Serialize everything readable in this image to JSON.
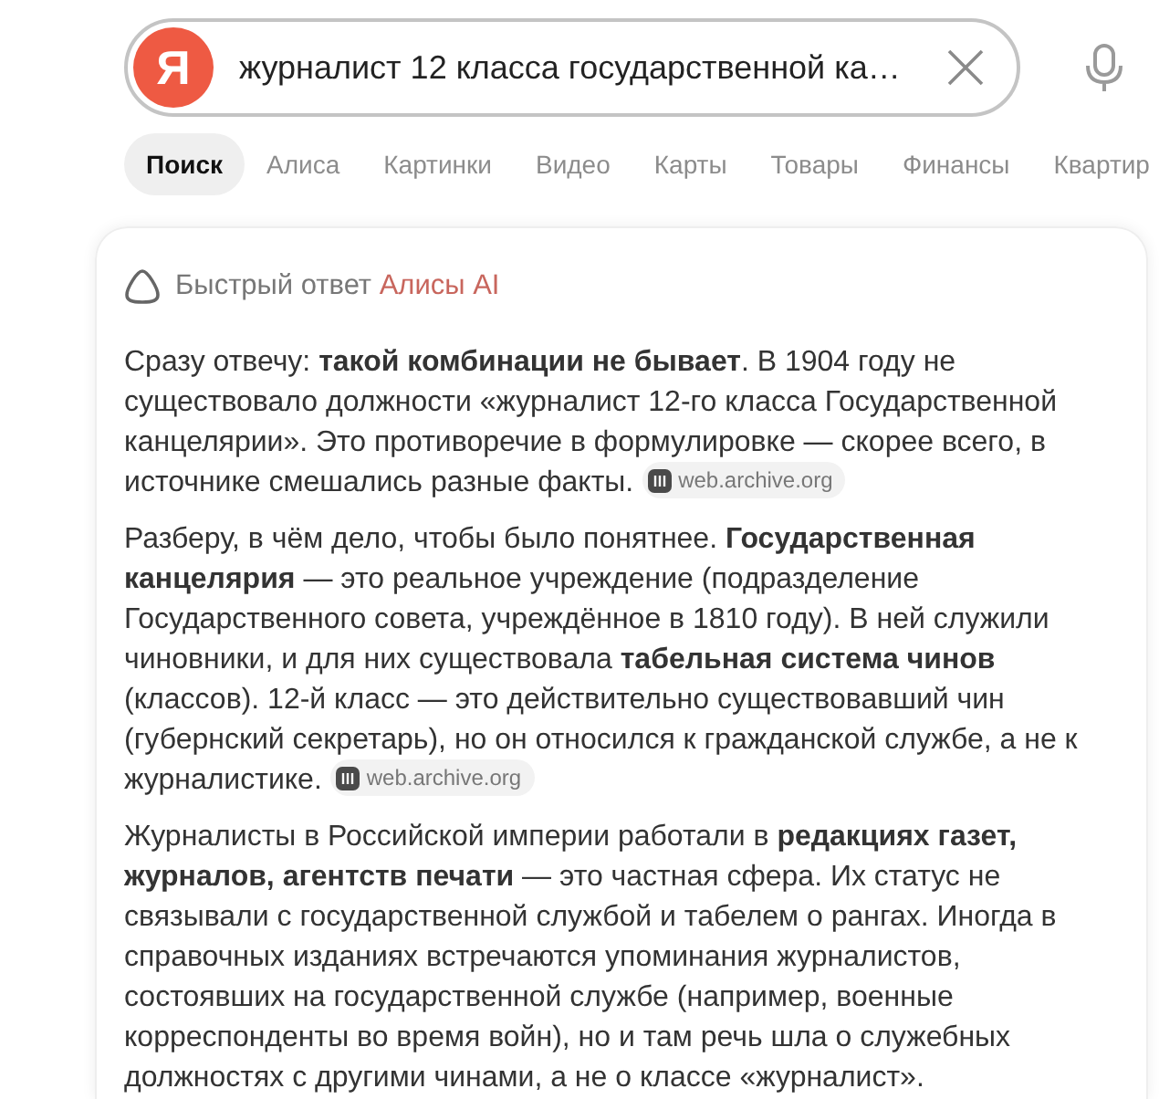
{
  "search": {
    "logo": "Я",
    "query": "журналист 12 класса государственной ка…"
  },
  "tabs": [
    {
      "label": "Поиск",
      "selected": true
    },
    {
      "label": "Алиса",
      "selected": false
    },
    {
      "label": "Картинки",
      "selected": false
    },
    {
      "label": "Видео",
      "selected": false
    },
    {
      "label": "Карты",
      "selected": false
    },
    {
      "label": "Товары",
      "selected": false
    },
    {
      "label": "Финансы",
      "selected": false
    },
    {
      "label": "Квартир",
      "selected": false
    }
  ],
  "answer": {
    "heading": "Быстрый ответ",
    "heading_accent": "Алисы AI",
    "paragraphs": [
      {
        "text": "Сразу отвечу: **такой комбинации не бывает**. В 1904 году не существовало должности «журналист 12-го класса Государственной канцелярии». Это противоречие в формулировке — скорее всего, в источнике смешались разные факты.",
        "source": "web.archive.org"
      },
      {
        "text": "Разберу, в чём дело, чтобы было понятнее. **Государственная канцелярия** — это реальное учреждение (подразделение Государственного совета, учреждённое в 1810 году). В ней служили чиновники, и для них существовала **табельная система чинов** (классов). 12-й класс — это действительно существовавший чин (губернский секретарь), но он относился к гражданской службе, а не к журналистике.",
        "source": "web.archive.org"
      },
      {
        "text": "Журналисты в Российской империи работали в **редакциях газет, журналов, агентств печати** — это частная сфера. Их статус не связывали с государственной службой и табелем о рангах. Иногда в справочных изданиях встречаются упоминания журналистов, состоявших на государственной службе (например, военные корреспонденты во время войн), но и там речь шла о служебных должностях с другими чинами, а не о классе «журналист»."
      }
    ]
  }
}
